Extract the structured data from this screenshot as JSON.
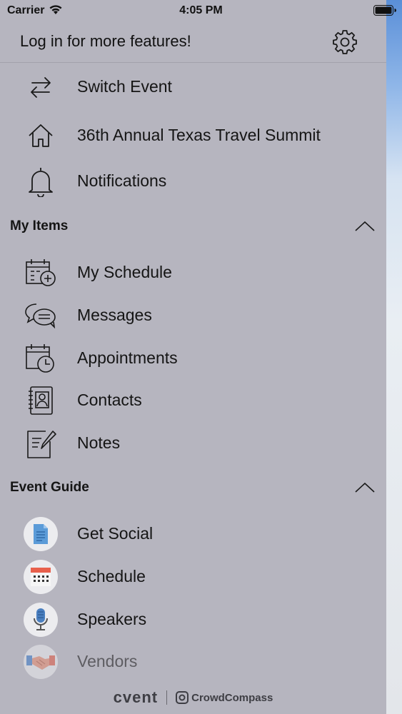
{
  "status_bar": {
    "carrier": "Carrier",
    "time": "4:05 PM"
  },
  "header": {
    "login_text": "Log in for more features!"
  },
  "top_items": [
    {
      "label": "Switch Event",
      "icon": "switch-arrows-icon"
    },
    {
      "label": "36th Annual Texas Travel Summit",
      "icon": "home-icon"
    },
    {
      "label": "Notifications",
      "icon": "bell-icon"
    }
  ],
  "my_items": {
    "title": "My Items",
    "items": [
      {
        "label": "My Schedule",
        "icon": "calendar-add-icon"
      },
      {
        "label": "Messages",
        "icon": "chat-bubbles-icon"
      },
      {
        "label": "Appointments",
        "icon": "calendar-clock-icon"
      },
      {
        "label": "Contacts",
        "icon": "contact-book-icon"
      },
      {
        "label": "Notes",
        "icon": "note-pencil-icon"
      }
    ]
  },
  "event_guide": {
    "title": "Event Guide",
    "items": [
      {
        "label": "Get Social",
        "icon": "document-icon"
      },
      {
        "label": "Schedule",
        "icon": "calendar-grid-icon"
      },
      {
        "label": "Speakers",
        "icon": "microphone-icon"
      },
      {
        "label": "Vendors",
        "icon": "handshake-icon"
      }
    ]
  },
  "footer": {
    "brand": "cvent",
    "partner": "CrowdCompass"
  }
}
